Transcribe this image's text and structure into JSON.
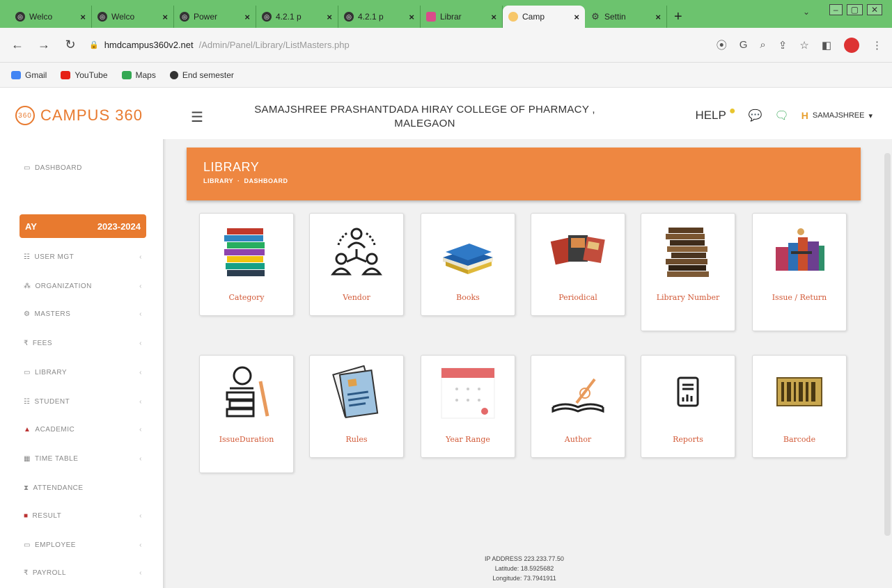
{
  "browser": {
    "tabs": [
      {
        "title": "Welco",
        "favicon": "globe-icon"
      },
      {
        "title": "Welco",
        "favicon": "globe-icon"
      },
      {
        "title": "Power",
        "favicon": "globe-icon"
      },
      {
        "title": "4.2.1 p",
        "favicon": "globe-icon"
      },
      {
        "title": "4.2.1 p",
        "favicon": "globe-icon"
      },
      {
        "title": "Librar",
        "favicon": "library-favicon"
      },
      {
        "title": "Camp",
        "favicon": "campus-favicon"
      },
      {
        "title": "Settin",
        "favicon": "gear-icon"
      }
    ],
    "tab_close": "×",
    "new_tab": "+",
    "url_host": "hmdcampus360v2.net",
    "url_path": "/Admin/Panel/Library/ListMasters.php",
    "bookmarks": [
      {
        "label": "Gmail",
        "color": "#4285f4"
      },
      {
        "label": "YouTube",
        "color": "#e62117"
      },
      {
        "label": "Maps",
        "color": "#34a853"
      },
      {
        "label": "End semester",
        "color": "#333333"
      }
    ]
  },
  "header": {
    "logo_text": "CAMPUS 360",
    "college_line1": "SAMAJSHREE PRASHANTDADA HIRAY COLLEGE OF PHARMACY ,",
    "college_line2": "MALEGAON",
    "help_label": "HELP",
    "user_name": "SAMAJSHREE",
    "user_caret": "▾",
    "accent": "#e87a2f"
  },
  "sidebar": {
    "dashboard": "DASHBOARD",
    "ay_label": "AY",
    "ay_value": "2023-2024",
    "items": [
      {
        "label": "USER MGT",
        "icon": "users-icon"
      },
      {
        "label": "ORGANIZATION",
        "icon": "org-icon"
      },
      {
        "label": "MASTERS",
        "icon": "masters-icon"
      },
      {
        "label": "FEES",
        "icon": "fees-icon"
      },
      {
        "label": "LIBRARY",
        "icon": "library-icon"
      },
      {
        "label": "STUDENT",
        "icon": "student-icon"
      },
      {
        "label": "ACADEMIC",
        "icon": "academic-icon"
      },
      {
        "label": "TIME TABLE",
        "icon": "timetable-icon"
      },
      {
        "label": "ATTENDANCE",
        "icon": "attendance-icon"
      },
      {
        "label": "RESULT",
        "icon": "result-icon"
      },
      {
        "label": "EMPLOYEE",
        "icon": "employee-icon"
      },
      {
        "label": "PAYROLL",
        "icon": "payroll-icon"
      }
    ]
  },
  "banner": {
    "title": "LIBRARY",
    "crumb1": "LIBRARY",
    "crumb2": "DASHBOARD",
    "color": "#ee8741"
  },
  "cards": [
    {
      "label": "Category",
      "icon": "category-books-icon"
    },
    {
      "label": "Vendor",
      "icon": "vendor-network-icon"
    },
    {
      "label": "Books",
      "icon": "books-icon"
    },
    {
      "label": "Periodical",
      "icon": "periodical-icon"
    },
    {
      "label": "Library Number",
      "icon": "library-number-icon"
    },
    {
      "label": "Issue / Return",
      "icon": "issue-return-icon"
    },
    {
      "label": "IssueDuration",
      "icon": "issue-duration-icon"
    },
    {
      "label": "Rules",
      "icon": "rules-icon"
    },
    {
      "label": "Year Range",
      "icon": "calendar-icon"
    },
    {
      "label": "Author",
      "icon": "author-pen-icon"
    },
    {
      "label": "Reports",
      "icon": "report-icon"
    },
    {
      "label": "Barcode",
      "icon": "barcode-icon"
    }
  ],
  "footer": {
    "ip": "IP ADDRESS 223.233.77.50",
    "lat": "Latitude: 18.5925682",
    "lng": "Longitude: 73.7941911"
  }
}
